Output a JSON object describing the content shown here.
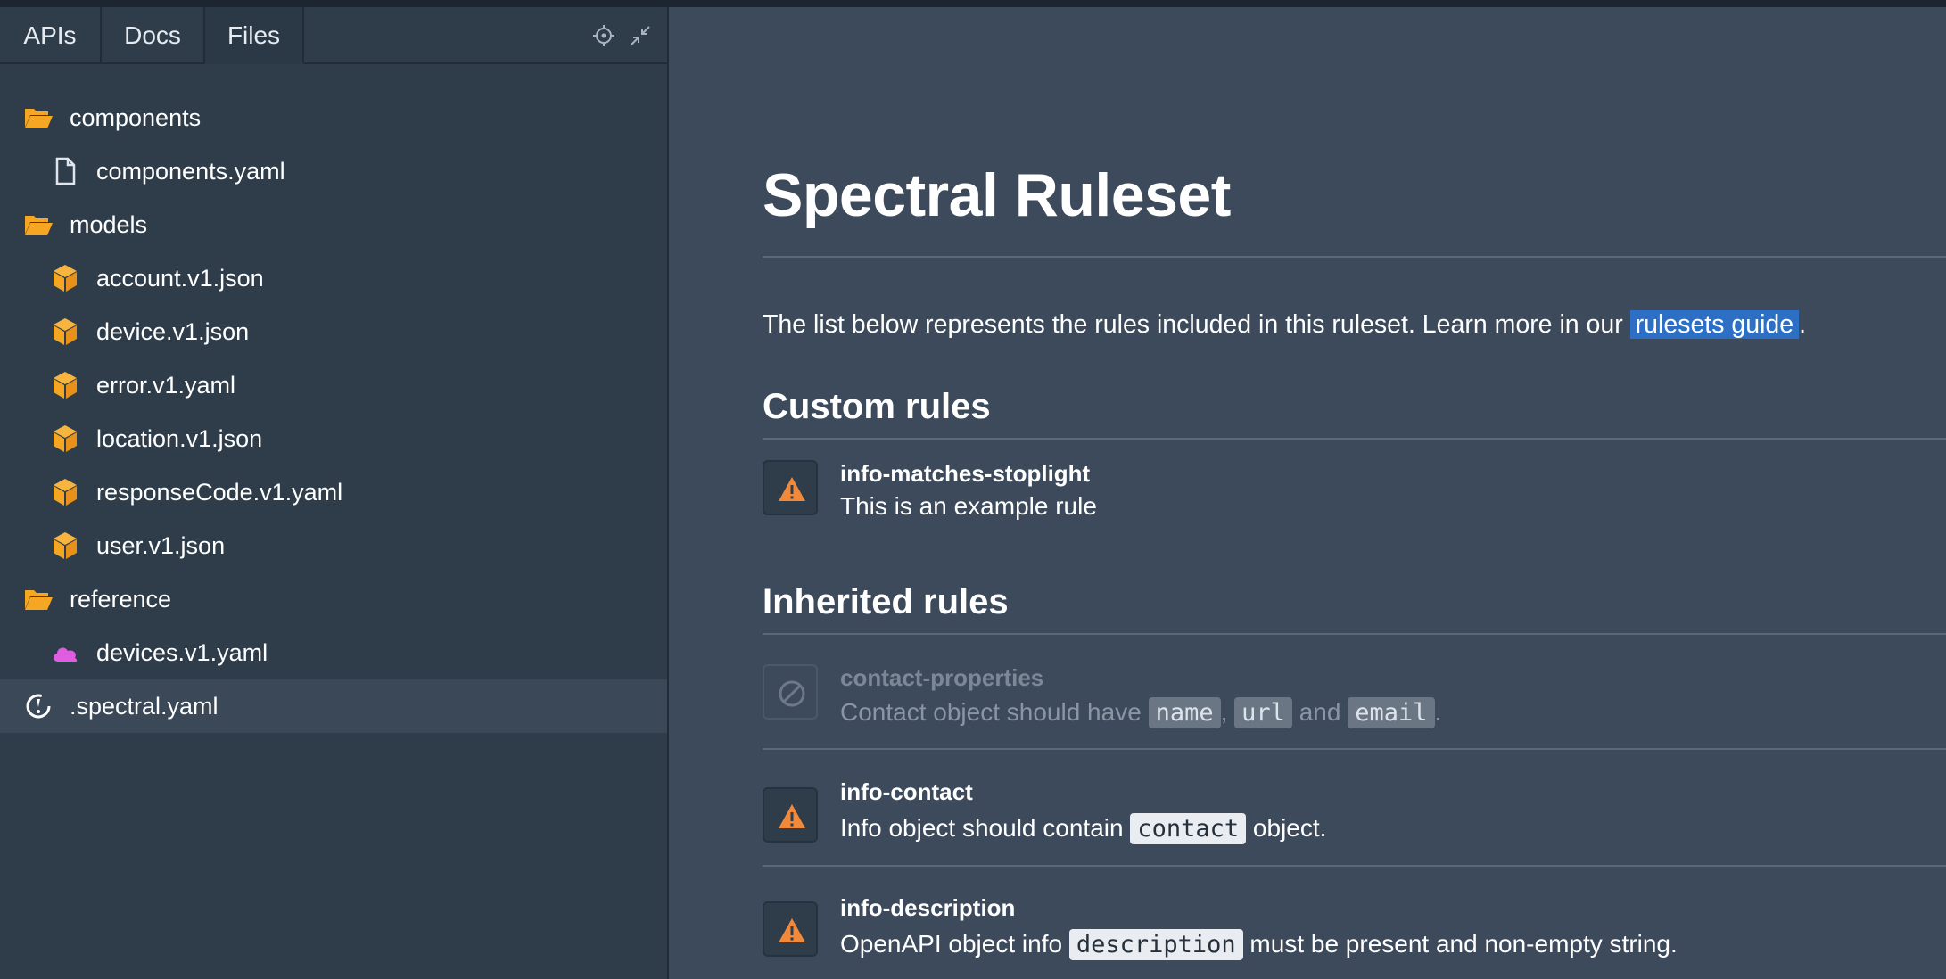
{
  "tabs": [
    {
      "label": "APIs"
    },
    {
      "label": "Docs"
    },
    {
      "label": "Files"
    }
  ],
  "toolbar": {
    "icons": [
      "crosshair-icon",
      "collapse-icon"
    ]
  },
  "tree": [
    {
      "label": "components",
      "icon": "folder-open-icon",
      "indent": 0
    },
    {
      "label": "components.yaml",
      "icon": "file-icon",
      "indent": 1
    },
    {
      "label": "models",
      "icon": "folder-open-icon",
      "indent": 0
    },
    {
      "label": "account.v1.json",
      "icon": "cube-icon",
      "indent": 1
    },
    {
      "label": "device.v1.json",
      "icon": "cube-icon",
      "indent": 1
    },
    {
      "label": "error.v1.yaml",
      "icon": "cube-icon",
      "indent": 1
    },
    {
      "label": "location.v1.json",
      "icon": "cube-icon",
      "indent": 1
    },
    {
      "label": "responseCode.v1.yaml",
      "icon": "cube-icon",
      "indent": 1
    },
    {
      "label": "user.v1.json",
      "icon": "cube-icon",
      "indent": 1
    },
    {
      "label": "reference",
      "icon": "folder-open-icon",
      "indent": 0
    },
    {
      "label": "devices.v1.yaml",
      "icon": "cloud-icon",
      "indent": 1
    },
    {
      "label": ".spectral.yaml",
      "icon": "spectral-icon",
      "indent": 0,
      "selected": true
    }
  ],
  "main": {
    "title": "Spectral Ruleset",
    "intro_text": "The list below represents the rules included in this ruleset. Learn more in our ",
    "intro_link": "rulesets guide",
    "intro_end": ".",
    "custom_heading": "Custom rules",
    "inherited_heading": "Inherited rules",
    "custom_rules": [
      {
        "name": "info-matches-stoplight",
        "desc": "This is an example rule",
        "icon": "warning-icon"
      }
    ],
    "inherited_rules": [
      {
        "name": "contact-properties",
        "icon": "disabled-icon",
        "disabled": true,
        "desc_parts": [
          "Contact object should have ",
          "name",
          ", ",
          "url",
          " and ",
          "email",
          "."
        ]
      },
      {
        "name": "info-contact",
        "icon": "warning-icon",
        "desc_parts": [
          "Info object should contain ",
          "contact",
          " object."
        ]
      },
      {
        "name": "info-description",
        "icon": "warning-icon",
        "desc_parts": [
          "OpenAPI object info ",
          "description",
          " must be present and non-empty string."
        ]
      }
    ]
  },
  "colors": {
    "accent_link": "#2d6fc4",
    "warning": "#f0893a",
    "folder": "#f5a623",
    "cube": "#f5a623",
    "cloud": "#e05ce0"
  }
}
